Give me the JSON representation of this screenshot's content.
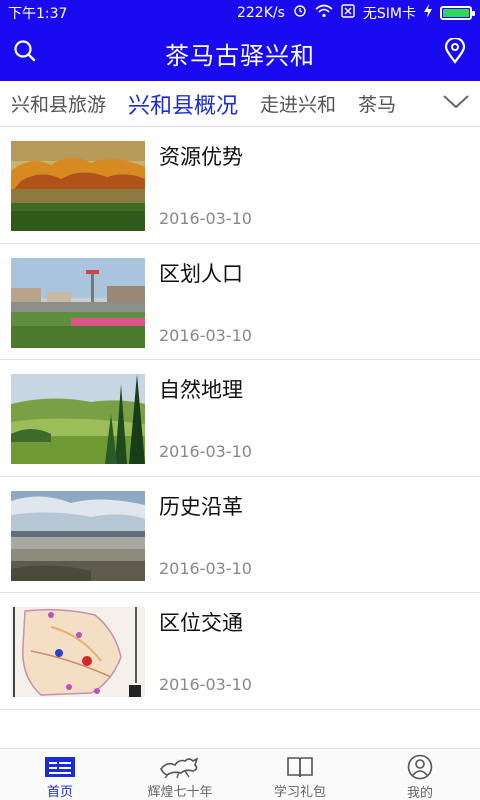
{
  "status_bar": {
    "time": "下午1:37",
    "speed": "222K/s",
    "sim": "无SIM卡"
  },
  "header": {
    "title": "茶马古驿兴和",
    "left_icon": "search-icon",
    "right_icon": "location-pin-icon"
  },
  "tabs": [
    {
      "label": "兴和县旅游"
    },
    {
      "label": "兴和县概况",
      "active": true
    },
    {
      "label": "走进兴和"
    },
    {
      "label": "茶马"
    }
  ],
  "tabs_more_icon": "chevron-down-icon",
  "articles": [
    {
      "title": "资源优势",
      "date": "2016-03-10"
    },
    {
      "title": "区划人口",
      "date": "2016-03-10"
    },
    {
      "title": "自然地理",
      "date": "2016-03-10"
    },
    {
      "title": "历史沿革",
      "date": "2016-03-10"
    },
    {
      "title": "区位交通",
      "date": "2016-03-10"
    }
  ],
  "bottom_nav": [
    {
      "label": "首页",
      "icon": "news-icon",
      "active": true
    },
    {
      "label": "辉煌七十年",
      "icon": "horse-icon"
    },
    {
      "label": "学习礼包",
      "icon": "book-icon"
    },
    {
      "label": "我的",
      "icon": "user-icon"
    }
  ],
  "colors": {
    "brand": "#1a0af0",
    "tab_active": "#1a2bd8",
    "battery": "#31d85a"
  }
}
